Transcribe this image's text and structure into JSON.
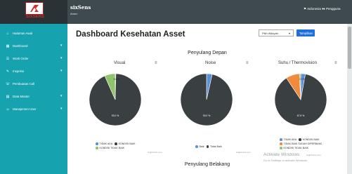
{
  "header": {
    "logo_text": "SIXSENS",
    "app_title": "sixSens",
    "app_subtitle": "Amen",
    "language": "Indonesia",
    "user": "Pengguna"
  },
  "sidebar": {
    "items": [
      {
        "icon": "home-icon",
        "label": "Halaman Awal",
        "chevron": false
      },
      {
        "icon": "dashboard-icon",
        "label": "Dashboard",
        "chevron": true
      },
      {
        "icon": "work-order-icon",
        "label": "Work Order",
        "chevron": true
      },
      {
        "icon": "inspection-icon",
        "label": "Inspeksi",
        "chevron": true
      },
      {
        "icon": "call-icon",
        "label": "Pembuatan Call",
        "chevron": false
      },
      {
        "icon": "data-master-icon",
        "label": "Data Master",
        "chevron": true
      },
      {
        "icon": "user-icon",
        "label": "Manajemen User",
        "chevron": true
      }
    ]
  },
  "main": {
    "page_title": "Dashboard Kesehatan Asset",
    "select_placeholder": "Pilih Wilayah",
    "show_button": "Tampilkan",
    "section_front": "Penyulang Depan",
    "section_back": "Penyulang Belakang"
  },
  "charts": {
    "visual": {
      "title": "Visual",
      "legend": [
        "TIDAK ADA",
        "KONDISI BAIK",
        "KONDISI TIDAK BAIK"
      ],
      "slice_labels": [
        "6.6 %",
        "93.0 %"
      ],
      "credit": "Highcharts.com"
    },
    "noise": {
      "title": "Noise",
      "legend": [
        "Baik",
        "Tidak Baik"
      ],
      "slice_labels": [
        "93.0 %"
      ],
      "credit": "Highcharts.com"
    },
    "thermo": {
      "title": "Suhu / Thermovision",
      "legend": [
        "TIDAK ADA",
        "KONDISI BAIK",
        "TIDAK BAIK SUDAH DIPERBAIKI",
        "KONDISI TIDAK BAIK"
      ],
      "slice_labels": [
        "2.9 %",
        "87.8 %"
      ],
      "credit": "Highcharts.com"
    }
  },
  "chart_data": [
    {
      "type": "pie",
      "title": "Visual",
      "categories": [
        "TIDAK ADA",
        "KONDISI BAIK",
        "KONDISI TIDAK BAIK"
      ],
      "values": [
        0.4,
        93.0,
        6.6
      ],
      "colors": [
        "#5b8fd6",
        "#3a3f41",
        "#8fc46b"
      ]
    },
    {
      "type": "pie",
      "title": "Noise",
      "categories": [
        "Baik",
        "Tidak Baik"
      ],
      "values": [
        3.5,
        96.5
      ],
      "colors": [
        "#5b8fd6",
        "#3a3f41"
      ]
    },
    {
      "type": "pie",
      "title": "Suhu / Thermovision",
      "categories": [
        "TIDAK ADA",
        "KONDISI BAIK",
        "TIDAK BAIK SUDAH DIPERBAIKI",
        "KONDISI TIDAK BAIK"
      ],
      "values": [
        2.9,
        87.8,
        8.5,
        0.8
      ],
      "colors": [
        "#5b8fd6",
        "#3a3f41",
        "#f08a3c",
        "#8fc46b"
      ]
    }
  ],
  "windows_notice": {
    "title": "Activate Windows",
    "subtitle": "Go to Settings to activate Windows."
  }
}
